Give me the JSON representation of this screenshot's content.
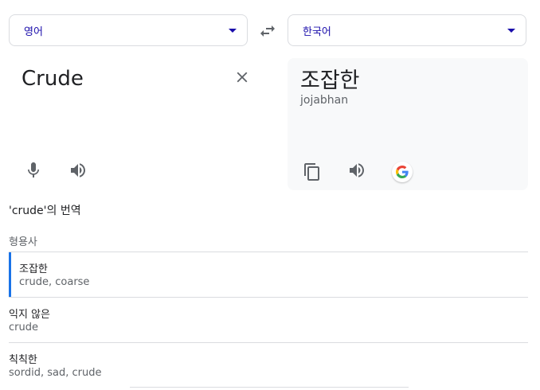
{
  "source_lang": {
    "label": "영어"
  },
  "target_lang": {
    "label": "한국어"
  },
  "source": {
    "text": "Crude"
  },
  "result": {
    "text": "조잡한",
    "transliteration": "jojabhan"
  },
  "dictionary": {
    "title": "'crude'의 번역",
    "pos": "형용사",
    "entries": [
      {
        "word": "조잡한",
        "synonyms": "crude, coarse"
      },
      {
        "word": "익지 않은",
        "synonyms": "crude"
      },
      {
        "word": "칙칙한",
        "synonyms": "sordid, sad, crude"
      }
    ]
  },
  "colors": {
    "accent": "#1a73e8",
    "link": "#1a0dab",
    "icon": "#5f6368"
  },
  "icons": [
    "chevron-down-icon",
    "swap-icon",
    "close-icon",
    "microphone-icon",
    "speaker-icon",
    "copy-icon",
    "google-logo-icon"
  ]
}
